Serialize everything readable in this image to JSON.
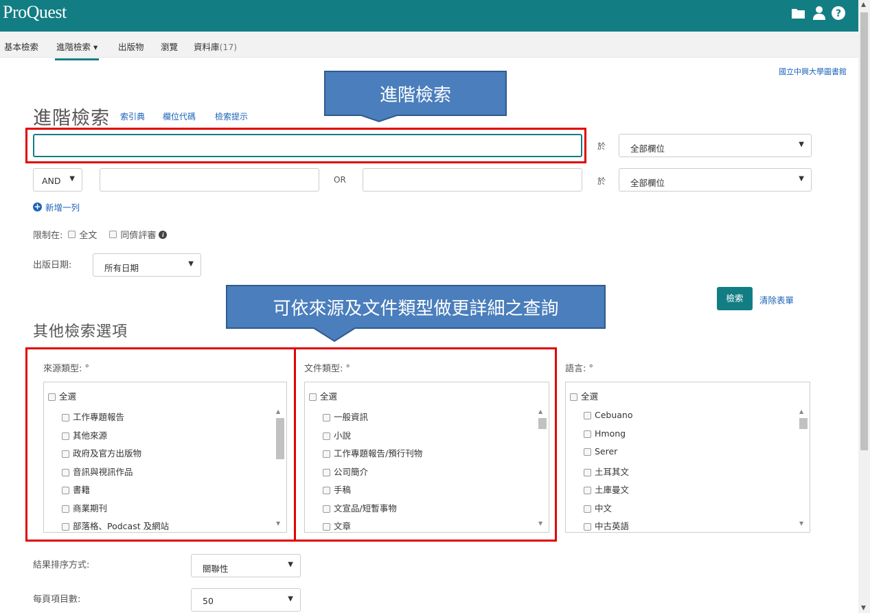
{
  "header": {
    "logo": "ProQuest",
    "icons": [
      "folder-icon",
      "user-icon",
      "help-icon"
    ]
  },
  "nav": {
    "items": [
      {
        "label": "基本檢索"
      },
      {
        "label": "進階檢索 ▾"
      },
      {
        "label": "出版物"
      },
      {
        "label": "瀏覽"
      },
      {
        "label": "資料庫",
        "count": "(17)"
      }
    ]
  },
  "library_name": "國立中興大學圖書館",
  "page": {
    "title": "進階檢索",
    "links": [
      "索引典",
      "欄位代碼",
      "檢索提示"
    ]
  },
  "search": {
    "row1": {
      "value": "",
      "in_label": "於",
      "field": "全部欄位"
    },
    "row2": {
      "operator": "AND",
      "value1": "",
      "or_label": "OR",
      "value2": "",
      "in_label": "於",
      "field": "全部欄位"
    },
    "add_row": "新增一列"
  },
  "limits": {
    "label": "限制在:",
    "full_text": "全文",
    "peer_reviewed": "同儕評審"
  },
  "pub_date": {
    "label": "出版日期:",
    "value": "所有日期"
  },
  "actions": {
    "search": "檢索",
    "clear": "清除表單"
  },
  "other_options": {
    "title": "其他檢索選項",
    "source_type": {
      "label": "來源類型: °",
      "select_all": "全選",
      "items": [
        "工作專題報告",
        "其他來源",
        "政府及官方出版物",
        "音訊與視訊作品",
        "書籍",
        "商業期刊",
        "部落格、Podcast 及網站"
      ]
    },
    "doc_type": {
      "label": "文件類型: °",
      "select_all": "全選",
      "items": [
        "一般資訊",
        "小說",
        "工作專題報告/預行刊物",
        "公司簡介",
        "手稿",
        "文宣品/短暫事物",
        "文章"
      ]
    },
    "language": {
      "label": "語言: °",
      "select_all": "全選",
      "items": [
        "Cebuano",
        "Hmong",
        "Serer",
        "土耳其文",
        "土庫曼文",
        "中文",
        "中古英語"
      ]
    }
  },
  "sort": {
    "label": "結果排序方式:",
    "value": "關聯性"
  },
  "per_page": {
    "label": "每頁項目數:",
    "value": "50"
  },
  "annotations": {
    "callout1": "進階檢索",
    "callout2": "可依來源及文件類型做更詳細之查詢"
  },
  "colors": {
    "teal": "#137d84",
    "link": "#1a62b8",
    "callout": "#4a7ebc",
    "highlight": "#e00000"
  }
}
